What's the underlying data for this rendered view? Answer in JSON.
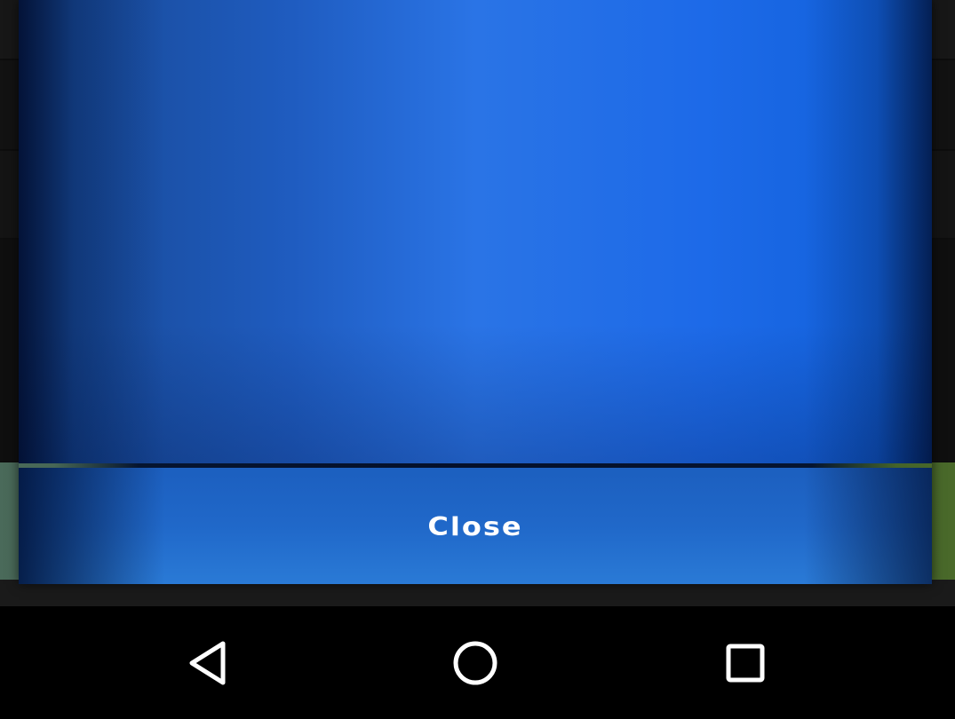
{
  "dialog": {
    "close_label": "Close",
    "colors": {
      "body_center": "#2a74e6",
      "body_edge": "#17468f",
      "footer": "#2068c9",
      "divider": "#05102a"
    }
  },
  "navbar": {
    "back_icon": "back-triangle-icon",
    "home_icon": "home-circle-icon",
    "recents_icon": "recents-square-icon",
    "icon_color": "#ffffff"
  }
}
